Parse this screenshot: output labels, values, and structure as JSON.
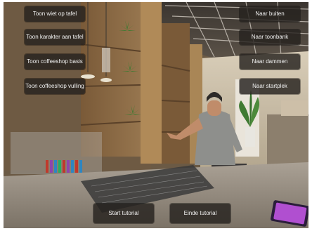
{
  "left_menu": {
    "buttons": [
      {
        "label": "Toon wiet op tafel"
      },
      {
        "label": "Toon karakter aan tafel"
      },
      {
        "label": "Toon coffeeshop basis"
      },
      {
        "label": "Toon coffeeshop vulling"
      }
    ]
  },
  "right_menu": {
    "buttons": [
      {
        "label": "Naar buiten"
      },
      {
        "label": "Naar toonbank"
      },
      {
        "label": "Naar dammen"
      },
      {
        "label": "Naar startplek"
      }
    ]
  },
  "bottom_bar": {
    "start_label": "Start tutorial",
    "end_label": "Einde tutorial"
  },
  "colors": {
    "button_bg": "#26221e",
    "button_text": "#f2f2f2",
    "wood": "#8a6a45",
    "counter": "#9a8f80",
    "leaf": "#3f7a32"
  }
}
